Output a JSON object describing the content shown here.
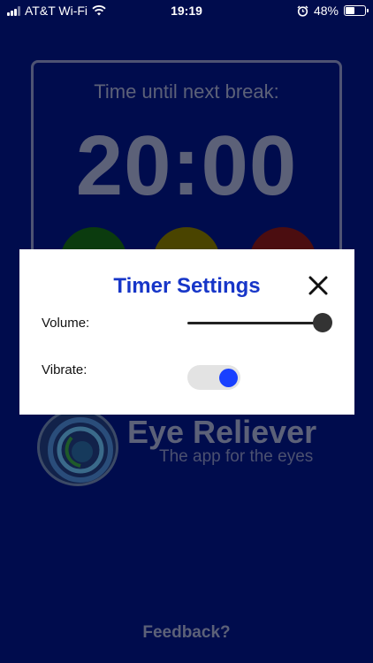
{
  "status_bar": {
    "carrier": "AT&T Wi-Fi",
    "time": "19:19",
    "battery": "48%",
    "battery_level": 0.48,
    "icons": [
      "signal-icon",
      "wifi-icon",
      "alarm-icon",
      "battery-icon"
    ]
  },
  "timer": {
    "label": "Time until next break:",
    "value": "20:00",
    "buttons": [
      "play-button",
      "pause-button",
      "stop-button"
    ]
  },
  "logo": {
    "title": "Eye Reliever",
    "subtitle": "The app for the eyes"
  },
  "footer": {
    "feedback": "Feedback?"
  },
  "modal": {
    "title": "Timer Settings",
    "volume_label": "Volume:",
    "volume_value": 1.0,
    "vibrate_label": "Vibrate:",
    "vibrate_on": true
  },
  "colors": {
    "background": "#000c4d",
    "modal_title": "#1736c8",
    "toggle_on": "#1940ff",
    "play": "#0b3b0e",
    "pause": "#4a4400",
    "stop": "#4b0d10"
  }
}
